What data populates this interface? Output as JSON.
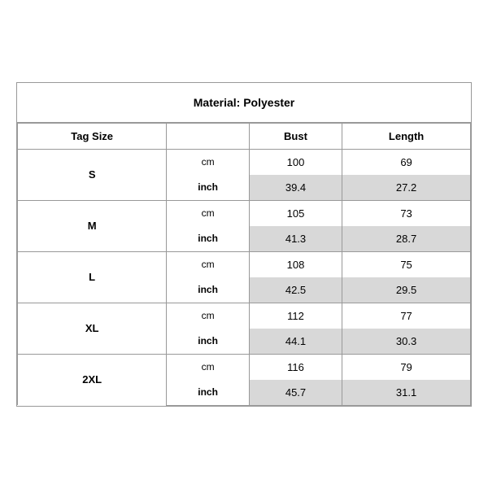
{
  "title": "Material: Polyester",
  "headers": {
    "tag_size": "Tag Size",
    "bust": "Bust",
    "length": "Length"
  },
  "sizes": [
    {
      "tag": "S",
      "cm": {
        "bust": "100",
        "length": "69"
      },
      "inch": {
        "bust": "39.4",
        "length": "27.2"
      }
    },
    {
      "tag": "M",
      "cm": {
        "bust": "105",
        "length": "73"
      },
      "inch": {
        "bust": "41.3",
        "length": "28.7"
      }
    },
    {
      "tag": "L",
      "cm": {
        "bust": "108",
        "length": "75"
      },
      "inch": {
        "bust": "42.5",
        "length": "29.5"
      }
    },
    {
      "tag": "XL",
      "cm": {
        "bust": "112",
        "length": "77"
      },
      "inch": {
        "bust": "44.1",
        "length": "30.3"
      }
    },
    {
      "tag": "2XL",
      "cm": {
        "bust": "116",
        "length": "79"
      },
      "inch": {
        "bust": "45.7",
        "length": "31.1"
      }
    }
  ],
  "labels": {
    "cm": "cm",
    "inch": "inch"
  }
}
